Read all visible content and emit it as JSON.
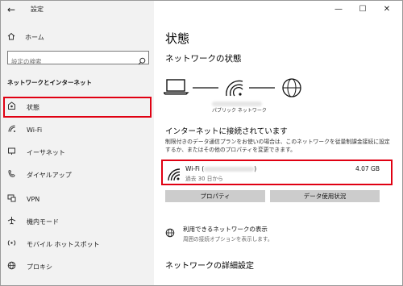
{
  "titlebar": {
    "app_title": "設定",
    "back_glyph": "←",
    "minimize_glyph": "—",
    "maximize_glyph": "☐",
    "close_glyph": "✕"
  },
  "sidebar": {
    "home_label": "ホーム",
    "search_placeholder": "設定の検索",
    "section_heading": "ネットワークとインターネット",
    "items": [
      {
        "label": "状態",
        "icon": "status-icon",
        "glyph": "⌂"
      },
      {
        "label": "Wi-Fi",
        "icon": "wifi-icon",
        "glyph": "◠"
      },
      {
        "label": "イーサネット",
        "icon": "ethernet-icon",
        "glyph": "▭"
      },
      {
        "label": "ダイヤルアップ",
        "icon": "dialup-icon",
        "glyph": "☏"
      },
      {
        "label": "VPN",
        "icon": "vpn-icon",
        "glyph": "∞"
      },
      {
        "label": "機内モード",
        "icon": "airplane-icon",
        "glyph": "✈"
      },
      {
        "label": "モバイル ホットスポット",
        "icon": "hotspot-icon",
        "glyph": "◍"
      },
      {
        "label": "プロキシ",
        "icon": "globe-icon",
        "glyph": "⊕"
      }
    ]
  },
  "main": {
    "page_title": "状態",
    "section_title": "ネットワークの状態",
    "diagram_caption": "パブリック ネットワーク",
    "connection_status": "インターネットに接続されています",
    "connection_description": "制限付きのデータ通信プランをお使いの場合は、このネットワークを従量制課金接続に設定するか、またはその他のプロパティを変更できます。",
    "wifi": {
      "name": "Wi-Fi (",
      "name_suffix": ")",
      "period": "過去 30 日から",
      "usage": "4.07 GB"
    },
    "buttons": {
      "properties": "プロパティ",
      "data_usage": "データ使用状況"
    },
    "available_networks": {
      "title": "利用できるネットワークの表示",
      "subtitle": "周囲の接続オプションを表示します。"
    },
    "advanced_title": "ネットワークの詳細設定"
  },
  "colors": {
    "highlight": "#e00012",
    "sidebar_bg": "#f2f2f2",
    "button_bg": "#cccccc"
  }
}
